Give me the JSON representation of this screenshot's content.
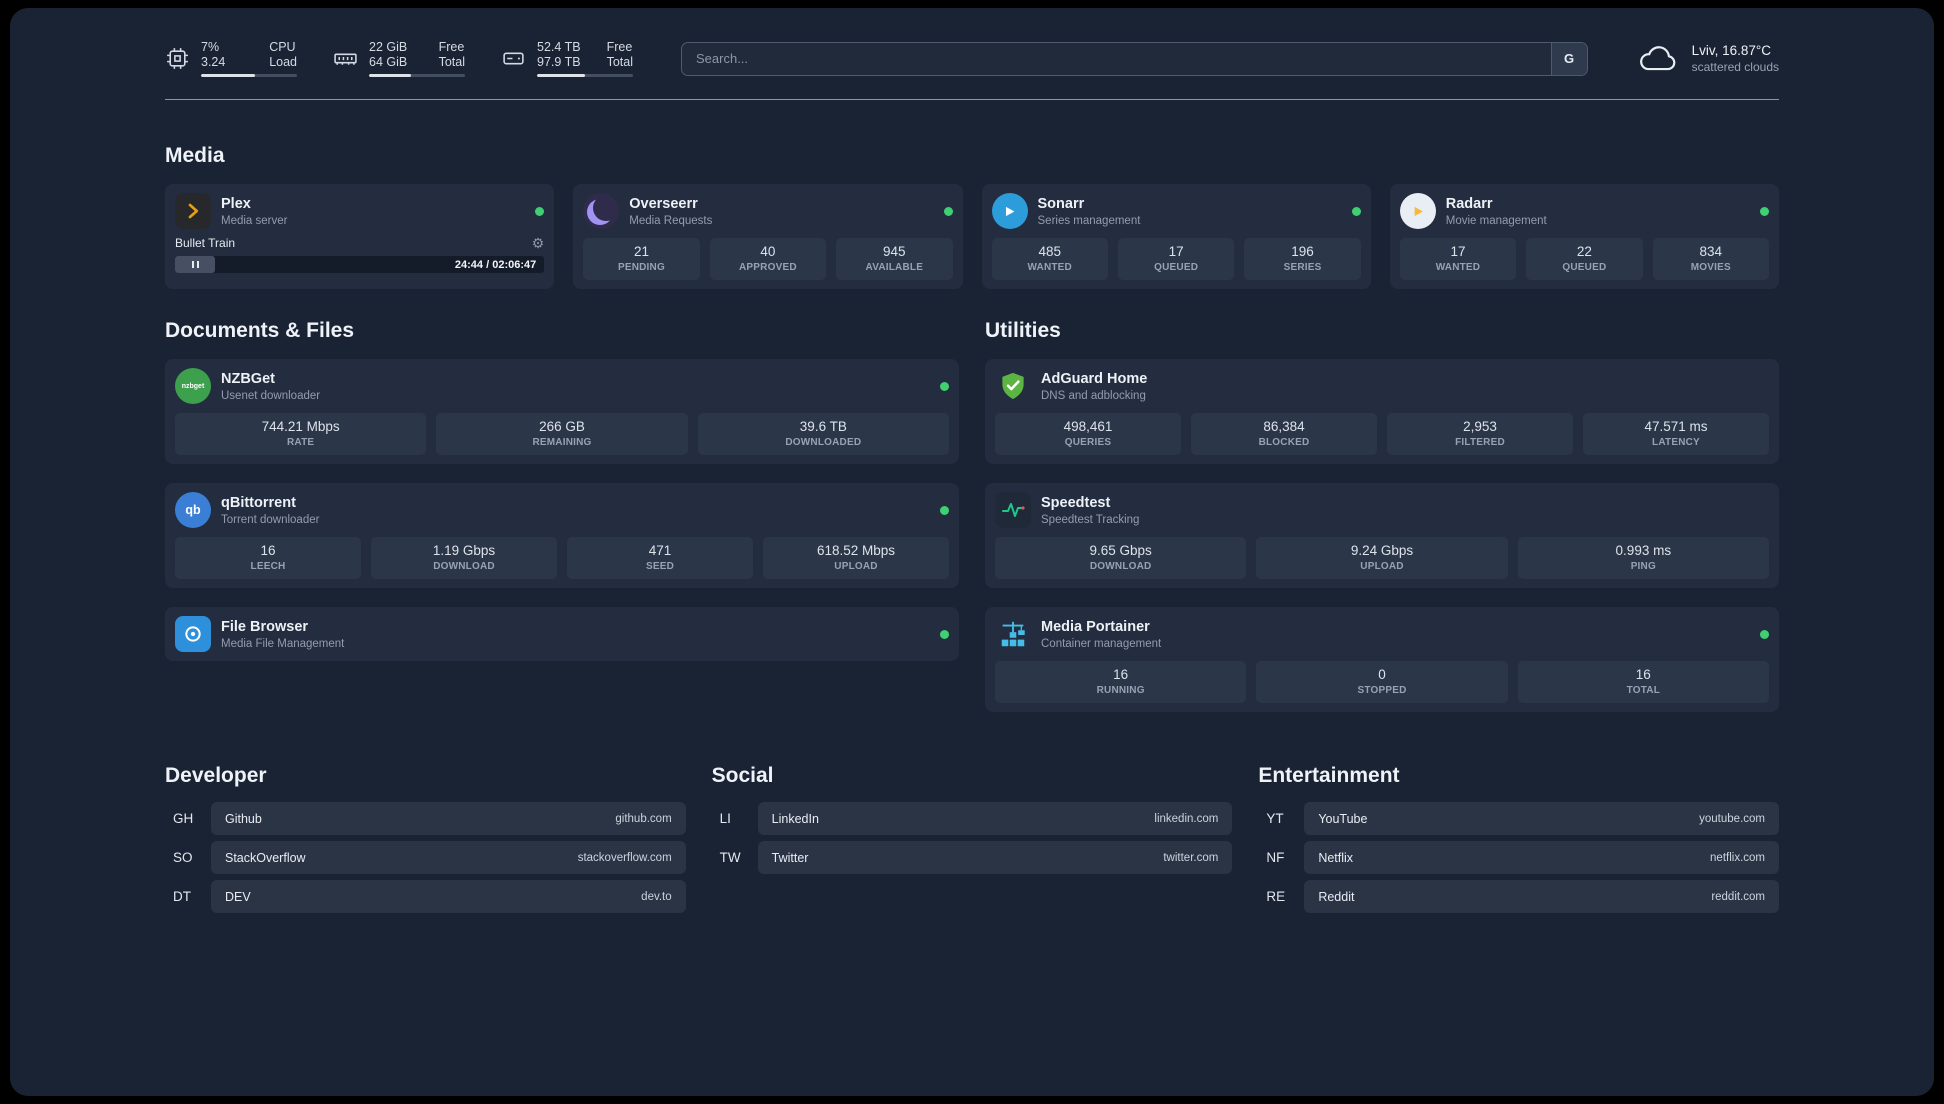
{
  "colors": {
    "status_online": "#3ed072",
    "background": "#1a2333",
    "card": "#232d3f"
  },
  "topbar": {
    "cpu": {
      "values": [
        "7%",
        "3.24"
      ],
      "labels": [
        "CPU",
        "Load"
      ],
      "bar_percent": 56
    },
    "memory": {
      "values": [
        "22 GiB",
        "64 GiB"
      ],
      "labels": [
        "Free",
        "Total"
      ],
      "bar_percent": 44
    },
    "disk": {
      "values": [
        "52.4 TB",
        "97.9 TB"
      ],
      "labels": [
        "Free",
        "Total"
      ],
      "bar_percent": 50
    },
    "search": {
      "placeholder": "Search...",
      "provider_label": "G"
    },
    "weather": {
      "location": "Lviv, 16.87°C",
      "condition": "scattered clouds"
    }
  },
  "sections": {
    "media": {
      "title": "Media",
      "plex": {
        "name": "Plex",
        "desc": "Media server",
        "now_playing": "Bullet Train",
        "time": "24:44 / 02:06:47"
      },
      "overseerr": {
        "name": "Overseerr",
        "desc": "Media Requests",
        "stats": [
          {
            "value": "21",
            "label": "PENDING"
          },
          {
            "value": "40",
            "label": "APPROVED"
          },
          {
            "value": "945",
            "label": "AVAILABLE"
          }
        ]
      },
      "sonarr": {
        "name": "Sonarr",
        "desc": "Series management",
        "stats": [
          {
            "value": "485",
            "label": "WANTED"
          },
          {
            "value": "17",
            "label": "QUEUED"
          },
          {
            "value": "196",
            "label": "SERIES"
          }
        ]
      },
      "radarr": {
        "name": "Radarr",
        "desc": "Movie management",
        "stats": [
          {
            "value": "17",
            "label": "WANTED"
          },
          {
            "value": "22",
            "label": "QUEUED"
          },
          {
            "value": "834",
            "label": "MOVIES"
          }
        ]
      }
    },
    "documents": {
      "title": "Documents & Files",
      "nzbget": {
        "name": "NZBGet",
        "desc": "Usenet downloader",
        "icon_text": "nzbget",
        "stats": [
          {
            "value": "744.21 Mbps",
            "label": "RATE"
          },
          {
            "value": "266 GB",
            "label": "REMAINING"
          },
          {
            "value": "39.6 TB",
            "label": "DOWNLOADED"
          }
        ]
      },
      "qbittorrent": {
        "name": "qBittorrent",
        "desc": "Torrent downloader",
        "icon_text": "qb",
        "stats": [
          {
            "value": "16",
            "label": "LEECH"
          },
          {
            "value": "1.19 Gbps",
            "label": "DOWNLOAD"
          },
          {
            "value": "471",
            "label": "SEED"
          },
          {
            "value": "618.52 Mbps",
            "label": "UPLOAD"
          }
        ]
      },
      "filebrowser": {
        "name": "File Browser",
        "desc": "Media File Management"
      }
    },
    "utilities": {
      "title": "Utilities",
      "adguard": {
        "name": "AdGuard Home",
        "desc": "DNS and adblocking",
        "stats": [
          {
            "value": "498,461",
            "label": "QUERIES"
          },
          {
            "value": "86,384",
            "label": "BLOCKED"
          },
          {
            "value": "2,953",
            "label": "FILTERED"
          },
          {
            "value": "47.571 ms",
            "label": "LATENCY"
          }
        ]
      },
      "speedtest": {
        "name": "Speedtest",
        "desc": "Speedtest Tracking",
        "stats": [
          {
            "value": "9.65 Gbps",
            "label": "DOWNLOAD"
          },
          {
            "value": "9.24 Gbps",
            "label": "UPLOAD"
          },
          {
            "value": "0.993 ms",
            "label": "PING"
          }
        ]
      },
      "portainer": {
        "name": "Media Portainer",
        "desc": "Container management",
        "stats": [
          {
            "value": "16",
            "label": "RUNNING"
          },
          {
            "value": "0",
            "label": "STOPPED"
          },
          {
            "value": "16",
            "label": "TOTAL"
          }
        ]
      }
    },
    "bookmarks": {
      "developer": {
        "title": "Developer",
        "items": [
          {
            "abbr": "GH",
            "name": "Github",
            "url": "github.com"
          },
          {
            "abbr": "SO",
            "name": "StackOverflow",
            "url": "stackoverflow.com"
          },
          {
            "abbr": "DT",
            "name": "DEV",
            "url": "dev.to"
          }
        ]
      },
      "social": {
        "title": "Social",
        "items": [
          {
            "abbr": "LI",
            "name": "LinkedIn",
            "url": "linkedin.com"
          },
          {
            "abbr": "TW",
            "name": "Twitter",
            "url": "twitter.com"
          }
        ]
      },
      "entertainment": {
        "title": "Entertainment",
        "items": [
          {
            "abbr": "YT",
            "name": "YouTube",
            "url": "youtube.com"
          },
          {
            "abbr": "NF",
            "name": "Netflix",
            "url": "netflix.com"
          },
          {
            "abbr": "RE",
            "name": "Reddit",
            "url": "reddit.com"
          }
        ]
      }
    }
  }
}
